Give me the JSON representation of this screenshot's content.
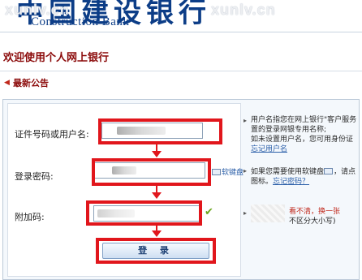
{
  "header": {
    "logo_cn": "中国建设银行",
    "logo_en": "Construction Bank",
    "watermark_left": "xunlv.cn",
    "watermark_right": "xunlv.cn"
  },
  "welcome": {
    "title": "欢迎使用个人网上银行"
  },
  "announcement": {
    "label": "最新公告"
  },
  "form": {
    "username_label": "证件号码或用户名:",
    "password_label": "登录密码:",
    "code_label": "附加码:",
    "soft_keyboard": "软键盘",
    "login_button": "登 录"
  },
  "hints": {
    "username": {
      "line1": "用户名指您在网上银行\"客户服务",
      "line2": "置的登录网银专用名称;",
      "line3": "如未设置用户名，您可用身份证",
      "forgot": "忘记用户名"
    },
    "password": {
      "line1": "如果您需要使用软键盘",
      "line1_tail": "，请点",
      "line2": "图标。",
      "forgot": "忘记密码？"
    },
    "code": {
      "unclear": "看不清，换一张",
      "case_note": "不区分大小写)"
    }
  },
  "colors": {
    "brand_blue": "#0c3d87",
    "title_red": "#8b0a0a",
    "highlight_red": "#e1161c",
    "link_blue": "#2a5ea8"
  }
}
